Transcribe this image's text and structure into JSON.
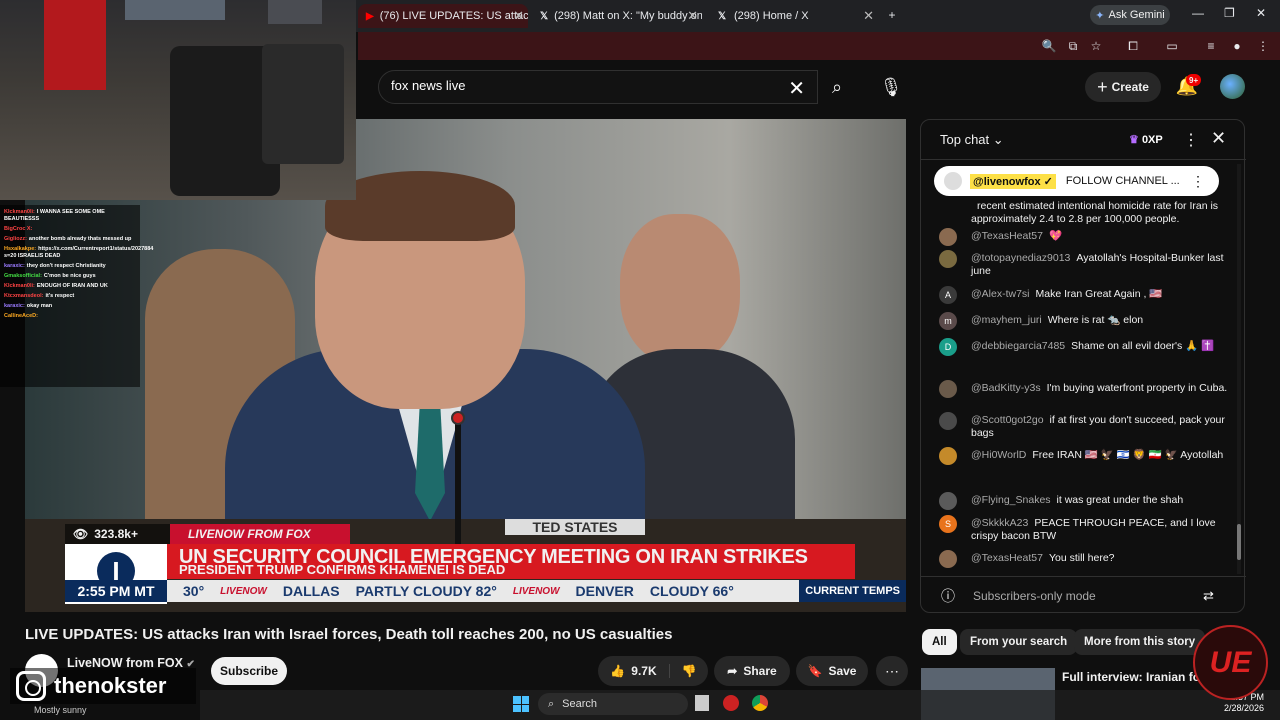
{
  "browser": {
    "tabs": [
      {
        "title": "(76) LIVE UPDATES: US attac",
        "favicon": "youtube-icon"
      },
      {
        "title": "(298) Matt on X: \"My buddy on",
        "favicon": "x-icon"
      },
      {
        "title": "(298) Home / X",
        "favicon": "x-icon"
      }
    ],
    "gemini_label": "Ask Gemini"
  },
  "webcam_chat": [
    {
      "user": "Klckman0li:",
      "text": "I WANNA SEE SOME OME BEAUTIESSS",
      "color": "#ff4444"
    },
    {
      "user": "BigCroc X:",
      "text": "",
      "color": "#ff4444"
    },
    {
      "user": "Gigliozz:",
      "text": "another bomb already thats messed up",
      "color": "#ff4444"
    },
    {
      "user": "Hsxalkakpe:",
      "text": "https://x.com/Currentreport1/status/2027884 s=20 ISRAELIS DEAD",
      "color": "#ffaa22"
    },
    {
      "user": "karaxic:",
      "text": "they don't respect Christianity",
      "color": "#9b7bff"
    },
    {
      "user": "Gmaksofficial:",
      "text": "C'mon be nice guys",
      "color": "#44dd44"
    },
    {
      "user": "Klckman0li:",
      "text": "ENOUGH OF IRAN AND UK",
      "color": "#ff4444"
    },
    {
      "user": "Ktcxmansdeol:",
      "text": "it's respect",
      "color": "#ff4444"
    },
    {
      "user": "karaxic:",
      "text": "okay man",
      "color": "#9b7bff"
    },
    {
      "user": "CallineAceD:",
      "text": "",
      "color": "#ffaa22"
    }
  ],
  "search": {
    "value": "fox news live"
  },
  "header": {
    "create_label": "Create",
    "notif_badge": "9+"
  },
  "video": {
    "viewers": "323.8k+",
    "source": "LIVENOW FROM FOX",
    "headline": "UN SECURITY COUNCIL EMERGENCY MEETING ON IRAN STRIKES",
    "subheadline": "PRESIDENT TRUMP CONFIRMS KHAMENEI IS DEAD",
    "time": "2:55 PM MT",
    "ticker": [
      "30°",
      "DALLAS",
      "PARTLY CLOUDY 82°",
      "DENVER",
      "CLOUDY 66°"
    ],
    "ticker_brand": "LIVENOW",
    "current_temps": "CURRENT TEMPS",
    "podium_text": "TED STATES"
  },
  "chat": {
    "title": "Top chat",
    "xp": "0XP",
    "pinned_channel": "@livenowfox ✓",
    "pinned_text": "FOLLOW CHANNEL ...",
    "messages": [
      {
        "author": "",
        "text": "recent estimated intentional homicide rate for Iran is approximately 2.4 to 2.8 per 100,000 people.",
        "av": "#555",
        "letter": ""
      },
      {
        "author": "@TexasHeat57",
        "text": "💖",
        "av": "#8a6a50",
        "letter": ""
      },
      {
        "author": "@totopaynediaz9013",
        "text": "Ayatollah's Hospital-Bunker last june",
        "av": "#7a6a40",
        "letter": ""
      },
      {
        "author": "@Alex-tw7si",
        "text": "Make Iran Great Again , 🇺🇸",
        "av": "#3a3a3a",
        "letter": "A"
      },
      {
        "author": "@mayhem_juri",
        "text": "Where is rat 🐀 elon",
        "av": "#5a4a4a",
        "letter": "m"
      },
      {
        "author": "@debbiegarcia7485",
        "text": "Shame on all evil doer's 🙏 ✝️",
        "av": "#1a9e8a",
        "letter": "D"
      },
      {
        "author": "@BadKitty-y3s",
        "text": "I'm buying waterfront property in Cuba.",
        "av": "#6a5a4a",
        "letter": ""
      },
      {
        "author": "@Scott0got2go",
        "text": "if at first you don't succeed, pack your bags",
        "av": "#4a4a4a",
        "letter": ""
      },
      {
        "author": "@Hi0WorlD",
        "text": "Free IRAN 🇺🇸 🦅 🇮🇱 🦁 🇮🇷 🦅 Ayotollah",
        "av": "#c48a2a",
        "letter": ""
      },
      {
        "author": "@Flying_Snakes",
        "text": "it was great under the shah",
        "av": "#5a5a5a",
        "letter": ""
      },
      {
        "author": "@SkkkkA23",
        "text": "PEACE THROUGH PEACE, and I love crispy bacon BTW",
        "av": "#e8731c",
        "letter": "S"
      },
      {
        "author": "@TexasHeat57",
        "text": "You still here?",
        "av": "#8a6a50",
        "letter": ""
      }
    ],
    "subscribers_only": "Subscribers-only mode"
  },
  "info": {
    "title": "LIVE UPDATES: US attacks Iran with Israel forces, Death toll reaches 200, no US casualties",
    "channel": "LiveNOW from FOX",
    "subscribe": "Subscribe",
    "likes": "9.7K",
    "share": "Share",
    "save": "Save"
  },
  "chips": [
    "All",
    "From your search",
    "More from this story"
  ],
  "recommended": {
    "title": "Full interview: Iranian forei"
  },
  "overlay": {
    "instagram": "thenokster",
    "weather": "Mostly sunny",
    "ue": "UE"
  },
  "taskbar": {
    "search": "Search",
    "time": "2:57 PM",
    "date": "2/28/2026"
  }
}
